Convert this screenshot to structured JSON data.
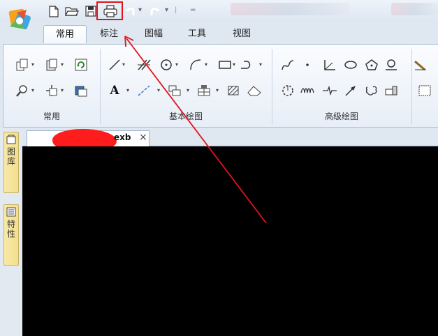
{
  "quick_access": {
    "items": [
      "new-file-icon",
      "open-folder-icon",
      "save-icon",
      "print-icon",
      "undo-icon",
      "redo-icon",
      "customize-icon"
    ]
  },
  "ribbon_tabs": [
    {
      "label": "常用",
      "active": true
    },
    {
      "label": "标注",
      "active": false
    },
    {
      "label": "图幅",
      "active": false
    },
    {
      "label": "工具",
      "active": false
    },
    {
      "label": "视图",
      "active": false
    }
  ],
  "ribbon_groups": [
    {
      "label": "常用"
    },
    {
      "label": "基本绘图"
    },
    {
      "label": "高级绘图"
    }
  ],
  "text_tool": {
    "glyph": "A"
  },
  "document": {
    "tab_name": "exb",
    "close_glyph": "×"
  },
  "side_panels": [
    {
      "label": "图库"
    },
    {
      "label": "特性"
    }
  ],
  "annotation": {
    "highlight_color": "#e1131b",
    "arrow_color": "#e1131b"
  }
}
